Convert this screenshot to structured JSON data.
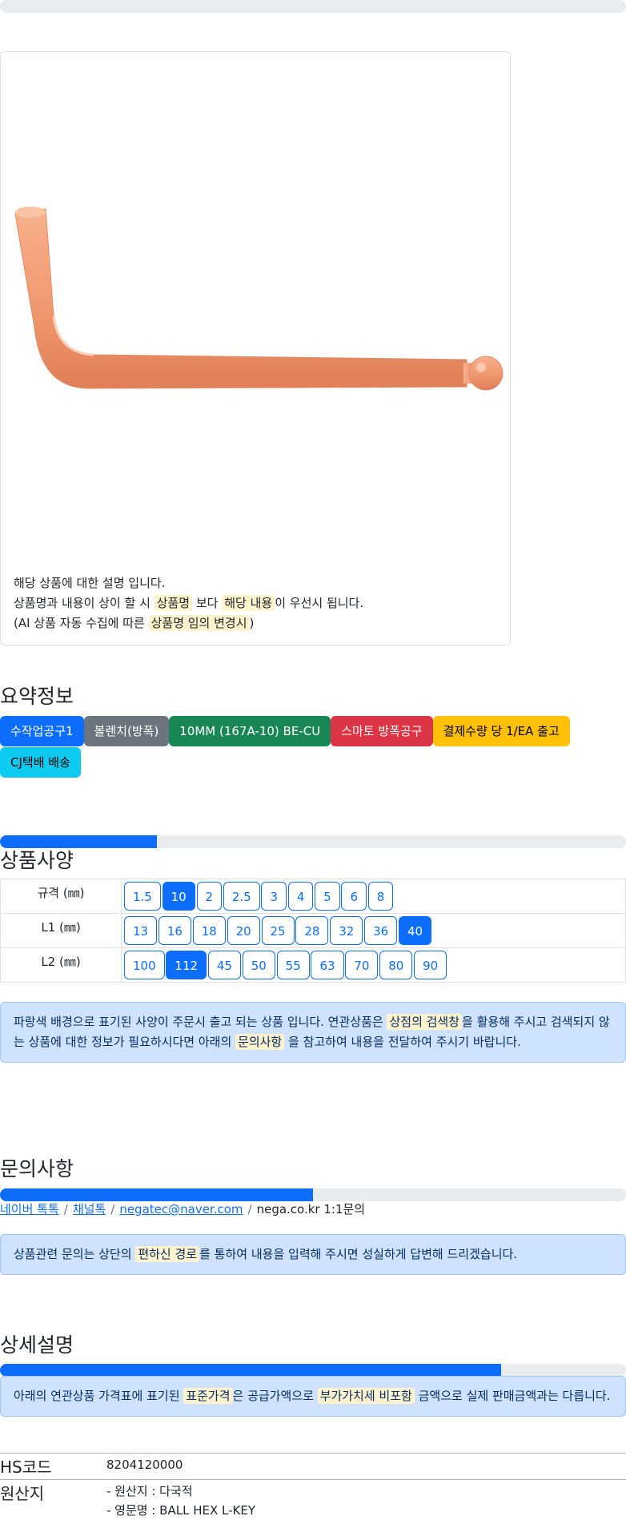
{
  "product_desc": {
    "line1": "해당 상품에 대한 설명 입니다.",
    "line2_a": "상품명과 내용이 상이 할 시",
    "line2_hl1": "상품명",
    "line2_b": "보다",
    "line2_hl2": "해당 내용",
    "line2_c": "이 우선시 됩니다.",
    "line3_a": "(AI 상품 자동 수집에 따른",
    "line3_hl": "상품명 임의 변경시",
    "line3_b": ")"
  },
  "summary": {
    "title": "요약정보",
    "badges": [
      {
        "label": "수작업공구1",
        "color": "#0d6efd"
      },
      {
        "label": "볼렌치(방폭)",
        "color": "#6c757d"
      },
      {
        "label": "10MM (167A-10) BE-CU",
        "color": "#198754"
      },
      {
        "label": "스마토 방폭공구",
        "color": "#dc3545"
      },
      {
        "label": "결제수량 당 1/EA 출고",
        "color": "#ffc107",
        "text_color": "#000000"
      },
      {
        "label": "CJ택배 배송",
        "color": "#0dcaf0",
        "text_color": "#000000"
      }
    ]
  },
  "spec": {
    "title": "상품사양",
    "progress": 0.25,
    "rows": [
      {
        "label": "규격 (㎜)",
        "options": [
          "1.5",
          "10",
          "2",
          "2.5",
          "3",
          "4",
          "5",
          "6",
          "8"
        ],
        "selected": "10"
      },
      {
        "label": "L1 (㎜)",
        "options": [
          "13",
          "16",
          "18",
          "20",
          "25",
          "28",
          "32",
          "36",
          "40"
        ],
        "selected": "40"
      },
      {
        "label": "L2 (㎜)",
        "options": [
          "100",
          "112",
          "45",
          "50",
          "55",
          "63",
          "70",
          "80",
          "90"
        ],
        "selected": "112"
      }
    ],
    "note_a": "파랑색 배경으로 표기된 사양이 주문시 출고 되는 상품 입니다. 연관상품은",
    "note_hl1": "상점의 검색창",
    "note_b": "을 활용해 주시고 검색되지 않는 상품에 대한 정보가 필요하시다면 아래의",
    "note_hl2": "문의사항",
    "note_c": "을 참고하여 내용을 전달하여 주시기 바랍니다."
  },
  "inquiry": {
    "title": "문의사항",
    "progress": 0.5,
    "link1": "네이버 톡톡",
    "link2": "채널톡",
    "link3": "negatec@naver.com",
    "text4": "nega.co.kr 1:1문의",
    "sep": "/",
    "note_a": "상품관련 문의는 상단의",
    "note_hl": "편하신 경로",
    "note_b": "를 통하여 내용을 입력해 주시면 성실하게 답변해 드리겠습니다."
  },
  "detail": {
    "title": "상세설명",
    "progress": 0.8,
    "note_a": "아래의 연관상품 가격표에 표기된",
    "note_hl1": "표준가격",
    "note_b": "은 공급가액으로",
    "note_hl2": "부가가치세 비포함",
    "note_c": "금액으로 실제 판매금액과는 다릅니다.",
    "hs_label": "HS코드",
    "hs_value": "8204120000",
    "origin_label": "원산지",
    "origin_line1": "- 원산지 : 다국적",
    "origin_line2": "- 영문명 : BALL HEX L-KEY"
  }
}
